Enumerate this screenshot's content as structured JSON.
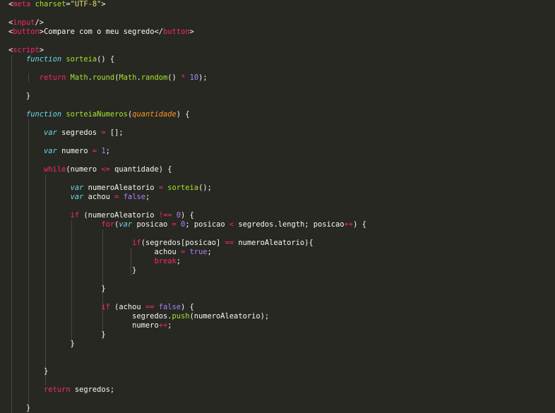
{
  "colors": {
    "background": "#272822",
    "text": "#f8f8f2",
    "keyword": "#f92672",
    "storage": "#66d9ef",
    "function_name": "#a6e22e",
    "string": "#e6db74",
    "number": "#ae81ff",
    "parameter": "#fd971f",
    "indent_guide": "#464741"
  },
  "editor": {
    "lines": [
      [
        {
          "t": "<",
          "c": "text"
        },
        {
          "t": "meta",
          "c": "keyword"
        },
        {
          "t": " ",
          "c": "text"
        },
        {
          "t": "charset",
          "c": "function_name"
        },
        {
          "t": "=",
          "c": "text"
        },
        {
          "t": "\"UTF-8\"",
          "c": "string"
        },
        {
          "t": ">",
          "c": "text"
        }
      ],
      [],
      [
        {
          "t": "<",
          "c": "text"
        },
        {
          "t": "input",
          "c": "keyword"
        },
        {
          "t": "/>",
          "c": "text"
        }
      ],
      [
        {
          "t": "<",
          "c": "text"
        },
        {
          "t": "button",
          "c": "keyword"
        },
        {
          "t": ">Compare com o meu segredo</",
          "c": "text"
        },
        {
          "t": "button",
          "c": "keyword"
        },
        {
          "t": ">",
          "c": "text"
        }
      ],
      [],
      [
        {
          "t": "<",
          "c": "text"
        },
        {
          "t": "script",
          "c": "keyword"
        },
        {
          "t": ">",
          "c": "text"
        }
      ],
      [
        {
          "t": "    ",
          "c": "text"
        },
        {
          "t": "function",
          "c": "storage"
        },
        {
          "t": " ",
          "c": "text"
        },
        {
          "t": "sorteia",
          "c": "function_name"
        },
        {
          "t": "() {",
          "c": "text"
        }
      ],
      [],
      [
        {
          "t": "       ",
          "c": "text"
        },
        {
          "t": "return",
          "c": "keyword"
        },
        {
          "t": " ",
          "c": "text"
        },
        {
          "t": "Math",
          "c": "function_name"
        },
        {
          "t": ".",
          "c": "text"
        },
        {
          "t": "round",
          "c": "function_name"
        },
        {
          "t": "(",
          "c": "text"
        },
        {
          "t": "Math",
          "c": "function_name"
        },
        {
          "t": ".",
          "c": "text"
        },
        {
          "t": "random",
          "c": "function_name"
        },
        {
          "t": "() ",
          "c": "text"
        },
        {
          "t": "*",
          "c": "keyword"
        },
        {
          "t": " ",
          "c": "text"
        },
        {
          "t": "10",
          "c": "number"
        },
        {
          "t": ");",
          "c": "text"
        }
      ],
      [],
      [
        {
          "t": "    }",
          "c": "text"
        }
      ],
      [],
      [
        {
          "t": "    ",
          "c": "text"
        },
        {
          "t": "function",
          "c": "storage"
        },
        {
          "t": " ",
          "c": "text"
        },
        {
          "t": "sorteiaNumeros",
          "c": "function_name"
        },
        {
          "t": "(",
          "c": "text"
        },
        {
          "t": "quantidade",
          "c": "parameter"
        },
        {
          "t": ") {",
          "c": "text"
        }
      ],
      [],
      [
        {
          "t": "        ",
          "c": "text"
        },
        {
          "t": "var",
          "c": "storage"
        },
        {
          "t": " segredos ",
          "c": "text"
        },
        {
          "t": "=",
          "c": "keyword"
        },
        {
          "t": " [];",
          "c": "text"
        }
      ],
      [],
      [
        {
          "t": "        ",
          "c": "text"
        },
        {
          "t": "var",
          "c": "storage"
        },
        {
          "t": " numero ",
          "c": "text"
        },
        {
          "t": "=",
          "c": "keyword"
        },
        {
          "t": " ",
          "c": "text"
        },
        {
          "t": "1",
          "c": "number"
        },
        {
          "t": ";",
          "c": "text"
        }
      ],
      [],
      [
        {
          "t": "        ",
          "c": "text"
        },
        {
          "t": "while",
          "c": "keyword"
        },
        {
          "t": "(numero ",
          "c": "text"
        },
        {
          "t": "<=",
          "c": "keyword"
        },
        {
          "t": " quantidade) {",
          "c": "text"
        }
      ],
      [],
      [
        {
          "t": "              ",
          "c": "text"
        },
        {
          "t": "var",
          "c": "storage"
        },
        {
          "t": " numeroAleatorio ",
          "c": "text"
        },
        {
          "t": "=",
          "c": "keyword"
        },
        {
          "t": " ",
          "c": "text"
        },
        {
          "t": "sorteia",
          "c": "function_name"
        },
        {
          "t": "();",
          "c": "text"
        }
      ],
      [
        {
          "t": "              ",
          "c": "text"
        },
        {
          "t": "var",
          "c": "storage"
        },
        {
          "t": " achou ",
          "c": "text"
        },
        {
          "t": "=",
          "c": "keyword"
        },
        {
          "t": " ",
          "c": "text"
        },
        {
          "t": "false",
          "c": "number"
        },
        {
          "t": ";",
          "c": "text"
        }
      ],
      [],
      [
        {
          "t": "              ",
          "c": "text"
        },
        {
          "t": "if",
          "c": "keyword"
        },
        {
          "t": " (numeroAleatorio ",
          "c": "text"
        },
        {
          "t": "!==",
          "c": "keyword"
        },
        {
          "t": " ",
          "c": "text"
        },
        {
          "t": "0",
          "c": "number"
        },
        {
          "t": ") {",
          "c": "text"
        }
      ],
      [
        {
          "t": "                     ",
          "c": "text"
        },
        {
          "t": "for",
          "c": "keyword"
        },
        {
          "t": "(",
          "c": "text"
        },
        {
          "t": "var",
          "c": "storage"
        },
        {
          "t": " posicao ",
          "c": "text"
        },
        {
          "t": "=",
          "c": "keyword"
        },
        {
          "t": " ",
          "c": "text"
        },
        {
          "t": "0",
          "c": "number"
        },
        {
          "t": "; posicao ",
          "c": "text"
        },
        {
          "t": "<",
          "c": "keyword"
        },
        {
          "t": " segredos.length; posicao",
          "c": "text"
        },
        {
          "t": "++",
          "c": "keyword"
        },
        {
          "t": ") {",
          "c": "text"
        }
      ],
      [],
      [
        {
          "t": "                            ",
          "c": "text"
        },
        {
          "t": "if",
          "c": "keyword"
        },
        {
          "t": "(segredos[posicao] ",
          "c": "text"
        },
        {
          "t": "==",
          "c": "keyword"
        },
        {
          "t": " numeroAleatorio){",
          "c": "text"
        }
      ],
      [
        {
          "t": "                                 achou ",
          "c": "text"
        },
        {
          "t": "=",
          "c": "keyword"
        },
        {
          "t": " ",
          "c": "text"
        },
        {
          "t": "true",
          "c": "number"
        },
        {
          "t": ";",
          "c": "text"
        }
      ],
      [
        {
          "t": "                                 ",
          "c": "text"
        },
        {
          "t": "break",
          "c": "keyword"
        },
        {
          "t": ";",
          "c": "text"
        }
      ],
      [
        {
          "t": "                            }",
          "c": "text"
        }
      ],
      [],
      [
        {
          "t": "                     }",
          "c": "text"
        }
      ],
      [],
      [
        {
          "t": "                     ",
          "c": "text"
        },
        {
          "t": "if",
          "c": "keyword"
        },
        {
          "t": " (achou ",
          "c": "text"
        },
        {
          "t": "==",
          "c": "keyword"
        },
        {
          "t": " ",
          "c": "text"
        },
        {
          "t": "false",
          "c": "number"
        },
        {
          "t": ") {",
          "c": "text"
        }
      ],
      [
        {
          "t": "                            segredos.",
          "c": "text"
        },
        {
          "t": "push",
          "c": "function_name"
        },
        {
          "t": "(numeroAleatorio);",
          "c": "text"
        }
      ],
      [
        {
          "t": "                            numero",
          "c": "text"
        },
        {
          "t": "++",
          "c": "keyword"
        },
        {
          "t": ";",
          "c": "text"
        }
      ],
      [
        {
          "t": "                     }",
          "c": "text"
        }
      ],
      [
        {
          "t": "              }",
          "c": "text"
        }
      ],
      [],
      [],
      [
        {
          "t": "        }",
          "c": "text"
        }
      ],
      [],
      [
        {
          "t": "        ",
          "c": "text"
        },
        {
          "t": "return",
          "c": "keyword"
        },
        {
          "t": " segredos;",
          "c": "text"
        }
      ],
      [],
      [
        {
          "t": "    }",
          "c": "text"
        }
      ]
    ]
  }
}
